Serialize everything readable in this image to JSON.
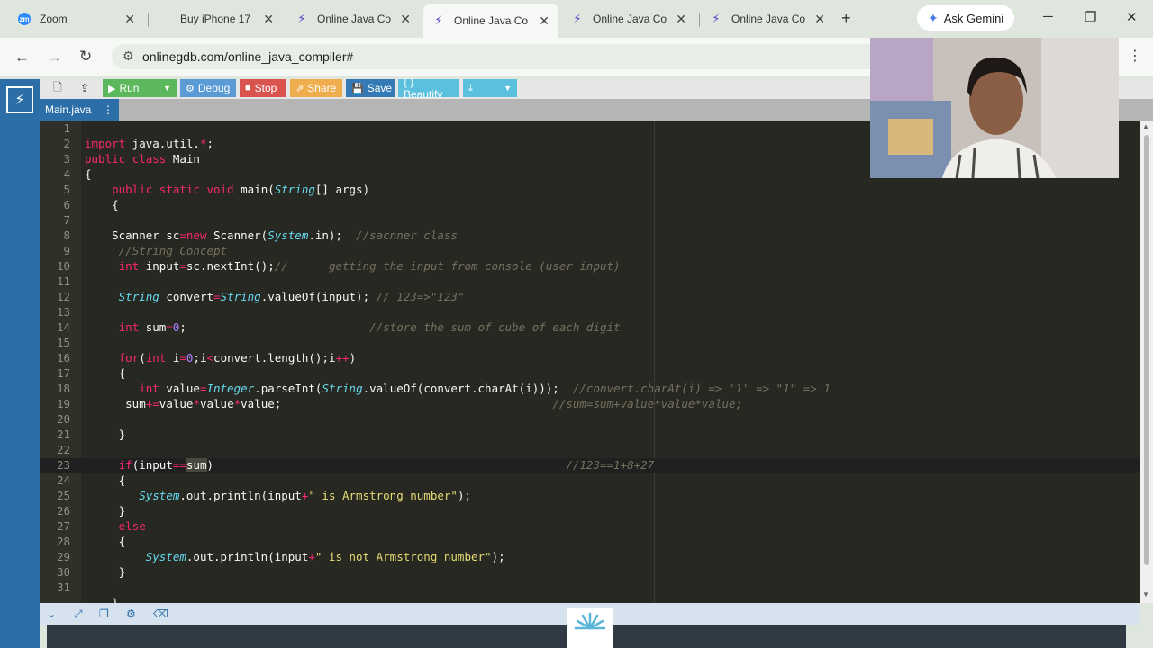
{
  "browser": {
    "tabs": [
      {
        "title": "Zoom",
        "icon": "zoom-icon"
      },
      {
        "title": "Buy iPhone 17",
        "icon": "apple-icon"
      },
      {
        "title": "Online Java Co",
        "icon": "onlinegdb-icon"
      },
      {
        "title": "Online Java Co",
        "icon": "onlinegdb-icon",
        "active": true
      },
      {
        "title": "Online Java Co",
        "icon": "onlinegdb-icon"
      },
      {
        "title": "Online Java Co",
        "icon": "onlinegdb-icon"
      }
    ],
    "gemini_label": "Ask Gemini",
    "url": "onlinegdb.com/online_java_compiler#"
  },
  "toolbar": {
    "run": "Run",
    "debug": "Debug",
    "stop": "Stop",
    "share": "Share",
    "save": "Save",
    "beautify": "{ } Beautify"
  },
  "file_tab": "Main.java",
  "editor": {
    "current_line": 23,
    "line_numbers": [
      "1",
      "2",
      "3",
      "4",
      "5",
      "6",
      "7",
      "8",
      "9",
      "10",
      "11",
      "12",
      "13",
      "14",
      "15",
      "16",
      "17",
      "18",
      "19",
      "20",
      "21",
      "22",
      "23",
      "24",
      "25",
      "26",
      "27",
      "28",
      "29",
      "30",
      "31"
    ]
  },
  "colors": {
    "rail": "#2b6ea8",
    "editor_bg": "#272822",
    "run": "#5cb85c",
    "debug": "#5b9bd5",
    "stop": "#d9534f",
    "share": "#f0ad4e",
    "save": "#337ab7",
    "beautify": "#5bc0de"
  }
}
